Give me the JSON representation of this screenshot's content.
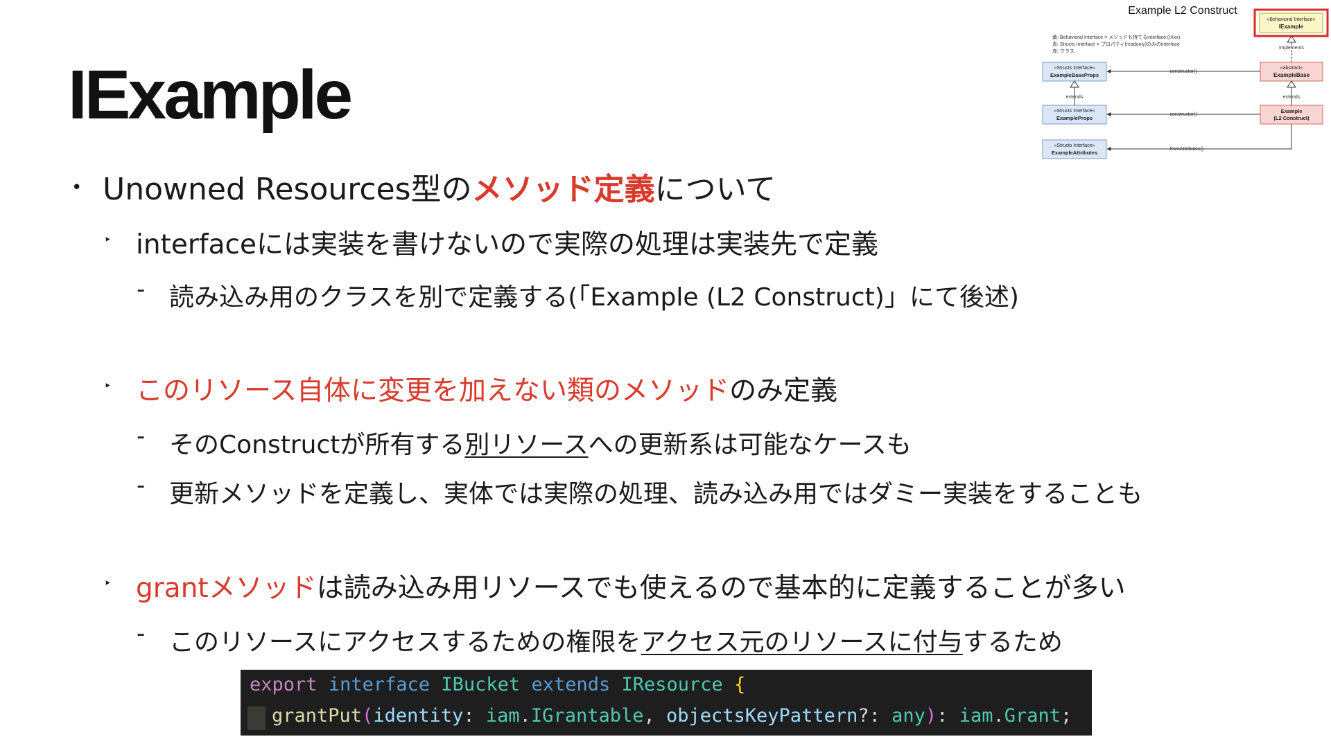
{
  "slide": {
    "title": "IExample",
    "point1": {
      "pre": "Unowned Resources型の",
      "highlight": "メソッド定義",
      "post": "について"
    },
    "sub1": {
      "text": "interfaceには実装を書けないので実際の処理は実装先で定義",
      "detail": "読み込み用のクラスを別で定義する(「Example (L2 Construct)」にて後述)"
    },
    "sub2": {
      "highlight": "このリソース自体に変更を加えない類のメソッド",
      "post": "のみ定義",
      "detail1": {
        "pre": "そのConstructが所有する",
        "underline": "別リソース",
        "post": "への更新系は可能なケースも"
      },
      "detail2": "更新メソッドを定義し、実体では実際の処理、読み込み用ではダミー実装をすることも"
    },
    "sub3": {
      "highlight": "grantメソッド",
      "post": "は読み込み用リソースでも使えるので基本的に定義することが多い",
      "detail": {
        "pre": "このリソースにアクセスするための権限を",
        "underline": "アクセス元のリソースに付与",
        "post": "するため"
      }
    }
  },
  "bullets": {
    "level1": "•",
    "level2": "‣",
    "level3": "-"
  },
  "code": {
    "line1": {
      "export": "export",
      "interface": "interface",
      "name": "IBucket",
      "extends": "extends",
      "parent": "IResource",
      "brace": "{"
    },
    "line2": {
      "method": "grantPut",
      "open_paren": "(",
      "param1": "identity",
      "colon1": ": ",
      "ns1": "iam",
      "dot1": ".",
      "type1": "IGrantable",
      "comma": ", ",
      "param2": "objectsKeyPattern",
      "optional": "?: ",
      "type2": "any",
      "close_paren": ")",
      "colon2": ": ",
      "ns2": "iam",
      "dot2": ".",
      "type3": "Grant",
      "semicolon": ";"
    }
  },
  "diagram": {
    "caption": "Example L2 Construct",
    "legend": [
      "黄: Behavioral Interface = メソッドも持てるinterface (IXxx)",
      "青: Structs Interface = プロパティ(readonly)のみのinterface",
      "赤: クラス"
    ],
    "boxes": {
      "iexample": {
        "stereotype": "«Behavioral Interface»",
        "name": "IExample"
      },
      "example_base_props": {
        "stereotype": "«Structs Interface»",
        "name": "ExampleBaseProps"
      },
      "example_base": {
        "stereotype": "«abstract»",
        "name": "ExampleBase"
      },
      "example_props": {
        "stereotype": "«Structs Interface»",
        "name": "ExampleProps"
      },
      "example": {
        "stereotype": "Example",
        "name": "(L2 Construct)"
      },
      "example_attributes": {
        "stereotype": "«Structs Interface»",
        "name": "ExampleAttributes"
      }
    },
    "relations": {
      "implements": "implements",
      "extends_left": "extends",
      "extends_right": "extends",
      "constructor_top": "constructor()",
      "constructor_mid": "constructor()",
      "from_attributes": "fromAttributes()"
    },
    "colors": {
      "yellow_fill": "#fdf7c8",
      "blue_fill": "#dbe7f7",
      "blue_border": "#7b9bc8",
      "red_fill": "#f8d5d2",
      "red_border": "#d26b63",
      "highlight_border": "#d62d20"
    }
  },
  "colors": {
    "accent_red": "#d93a2b",
    "text": "#1a1a1a",
    "code_bg": "#1e1e1e"
  }
}
